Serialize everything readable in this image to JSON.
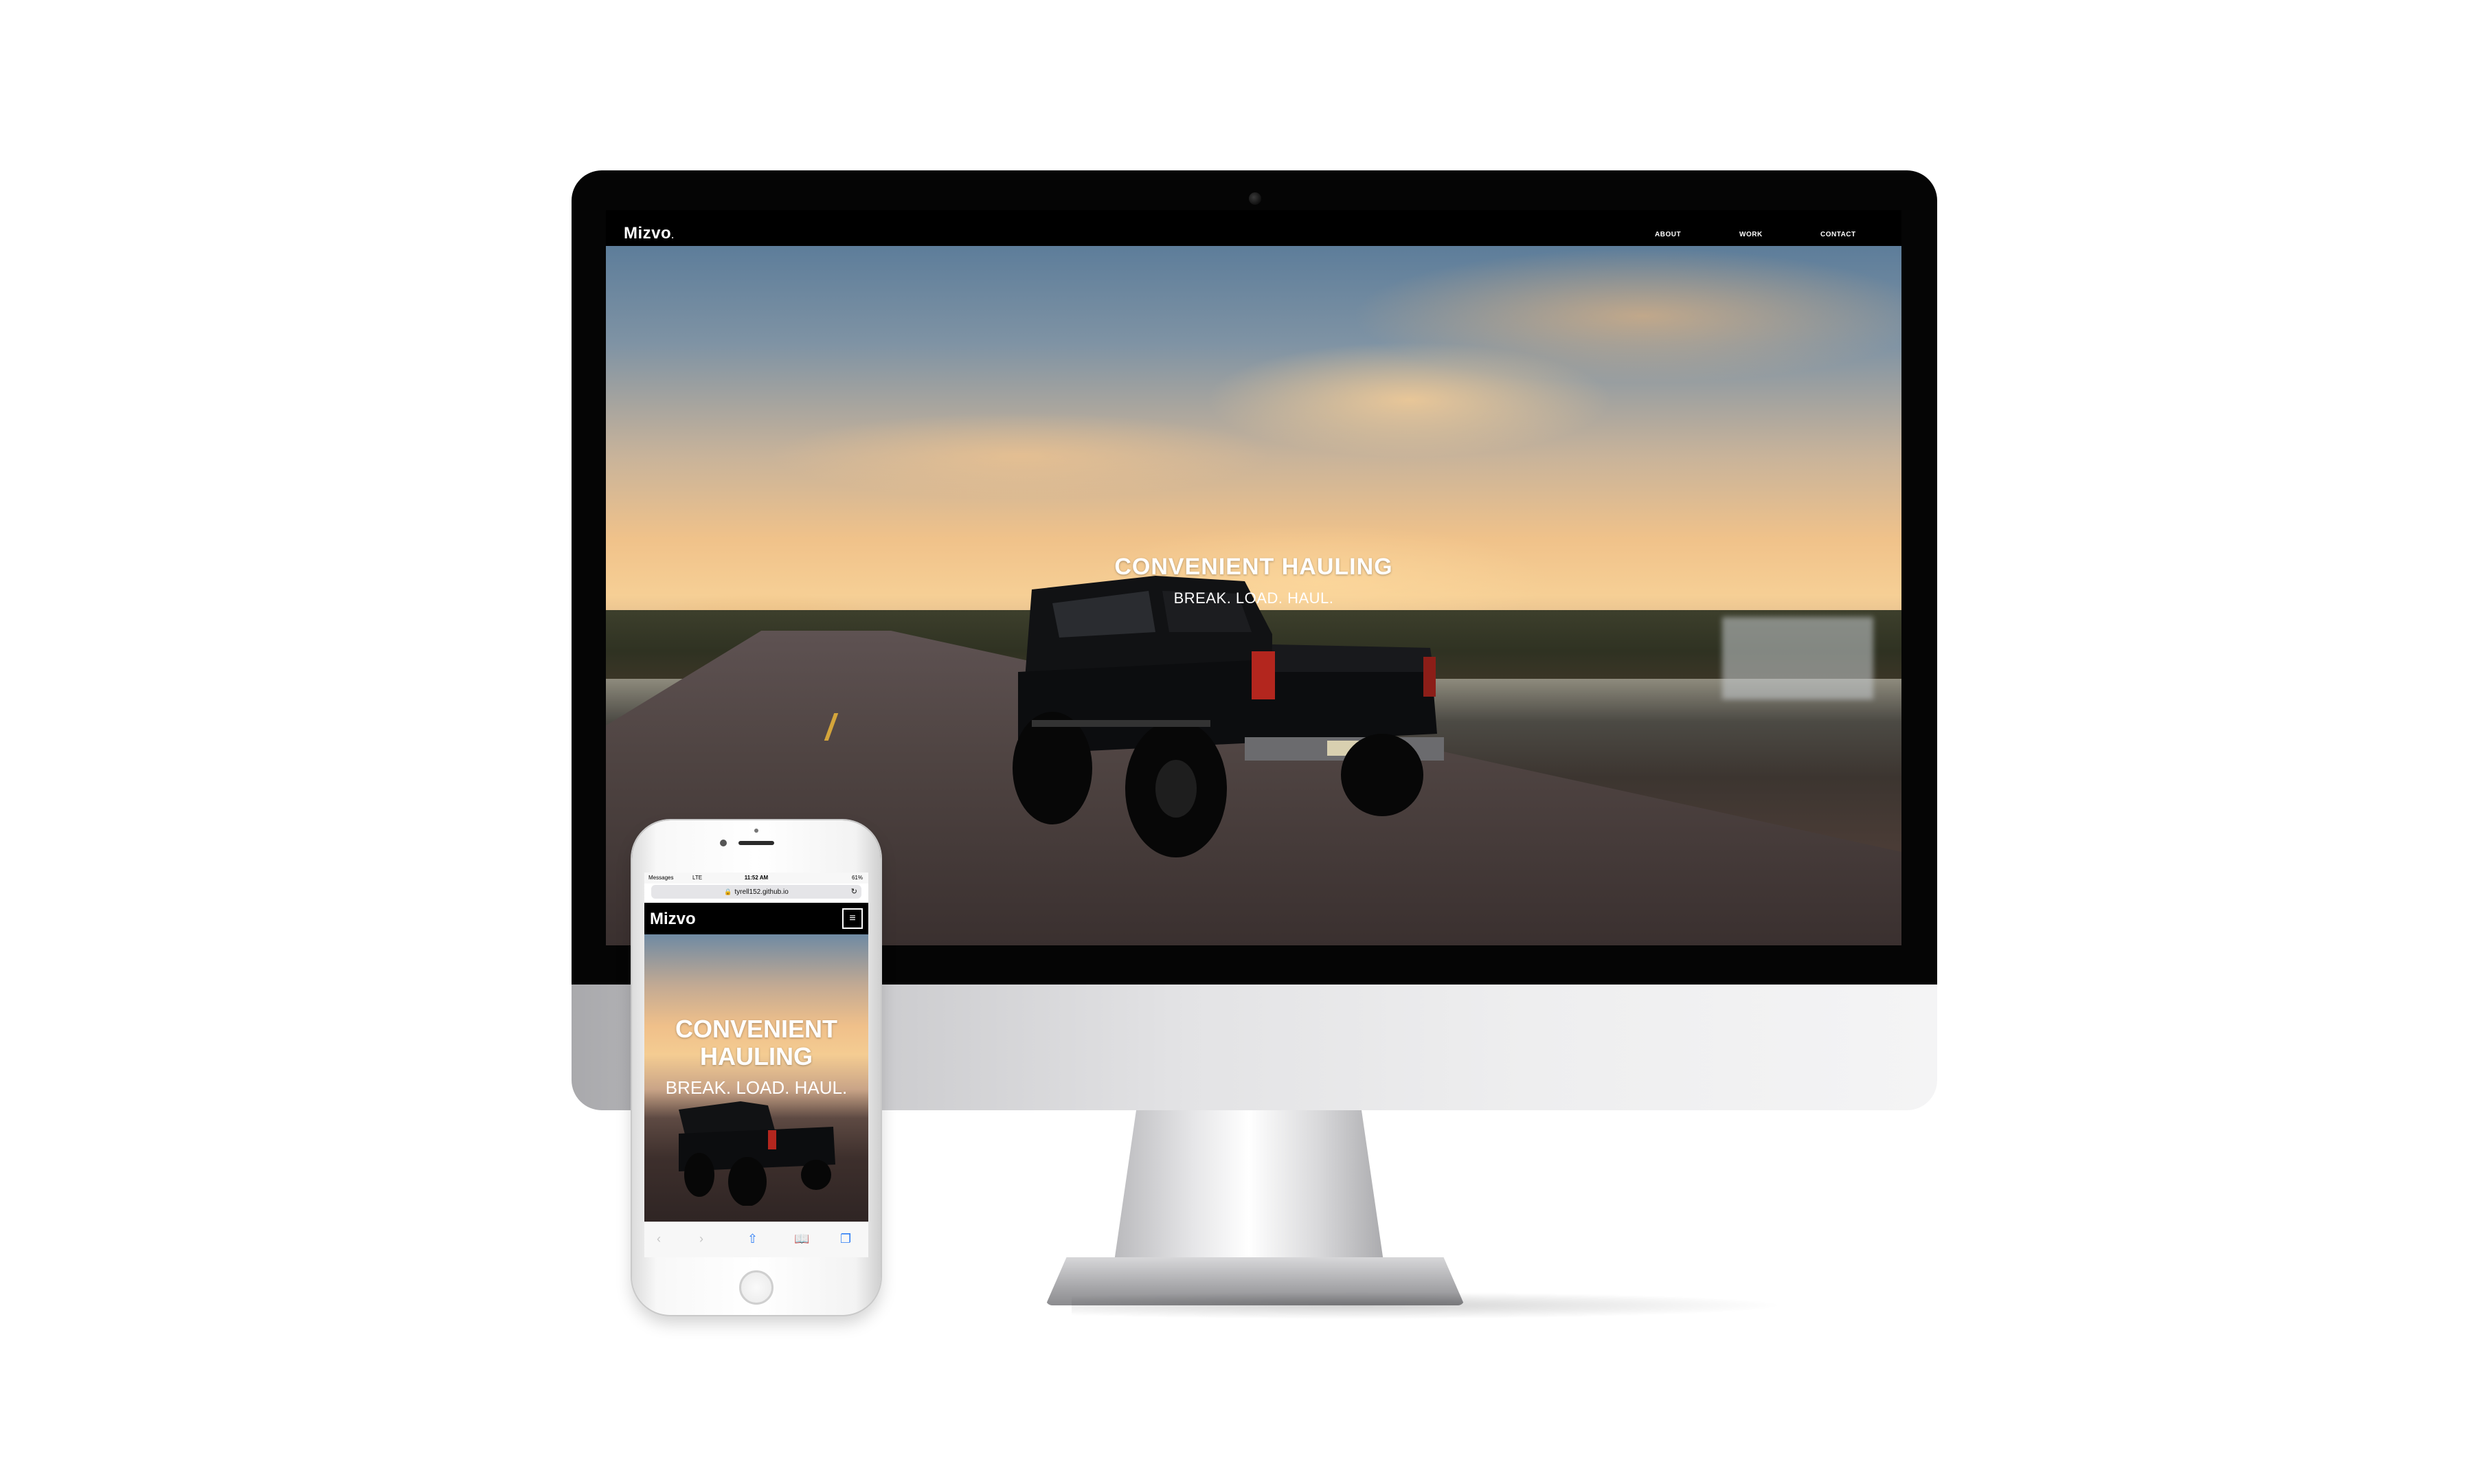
{
  "desktop": {
    "logo": "Mizvo",
    "nav": [
      "ABOUT",
      "WORK",
      "CONTACT"
    ],
    "hero_title": "CONVENIENT HAULING",
    "hero_subtitle": "BREAK. LOAD. HAUL."
  },
  "mobile": {
    "status": {
      "app": "Messages",
      "carrier": "LTE",
      "time": "11:52 AM",
      "battery": "61%"
    },
    "url": "tyrell152.github.io",
    "logo": "Mizvo",
    "menu_icon": "hamburger-icon",
    "hero_title_line1": "CONVENIENT",
    "hero_title_line2": "HAULING",
    "hero_subtitle": "BREAK. LOAD. HAUL.",
    "toolbar_icons": [
      "back-icon",
      "forward-icon",
      "share-icon",
      "bookmarks-icon",
      "tabs-icon"
    ]
  },
  "colors": {
    "sky_top": "#5d7d9a",
    "sunset": "#f6cf95",
    "road": "#4f4442",
    "ios_blue": "#2f7ef5"
  }
}
